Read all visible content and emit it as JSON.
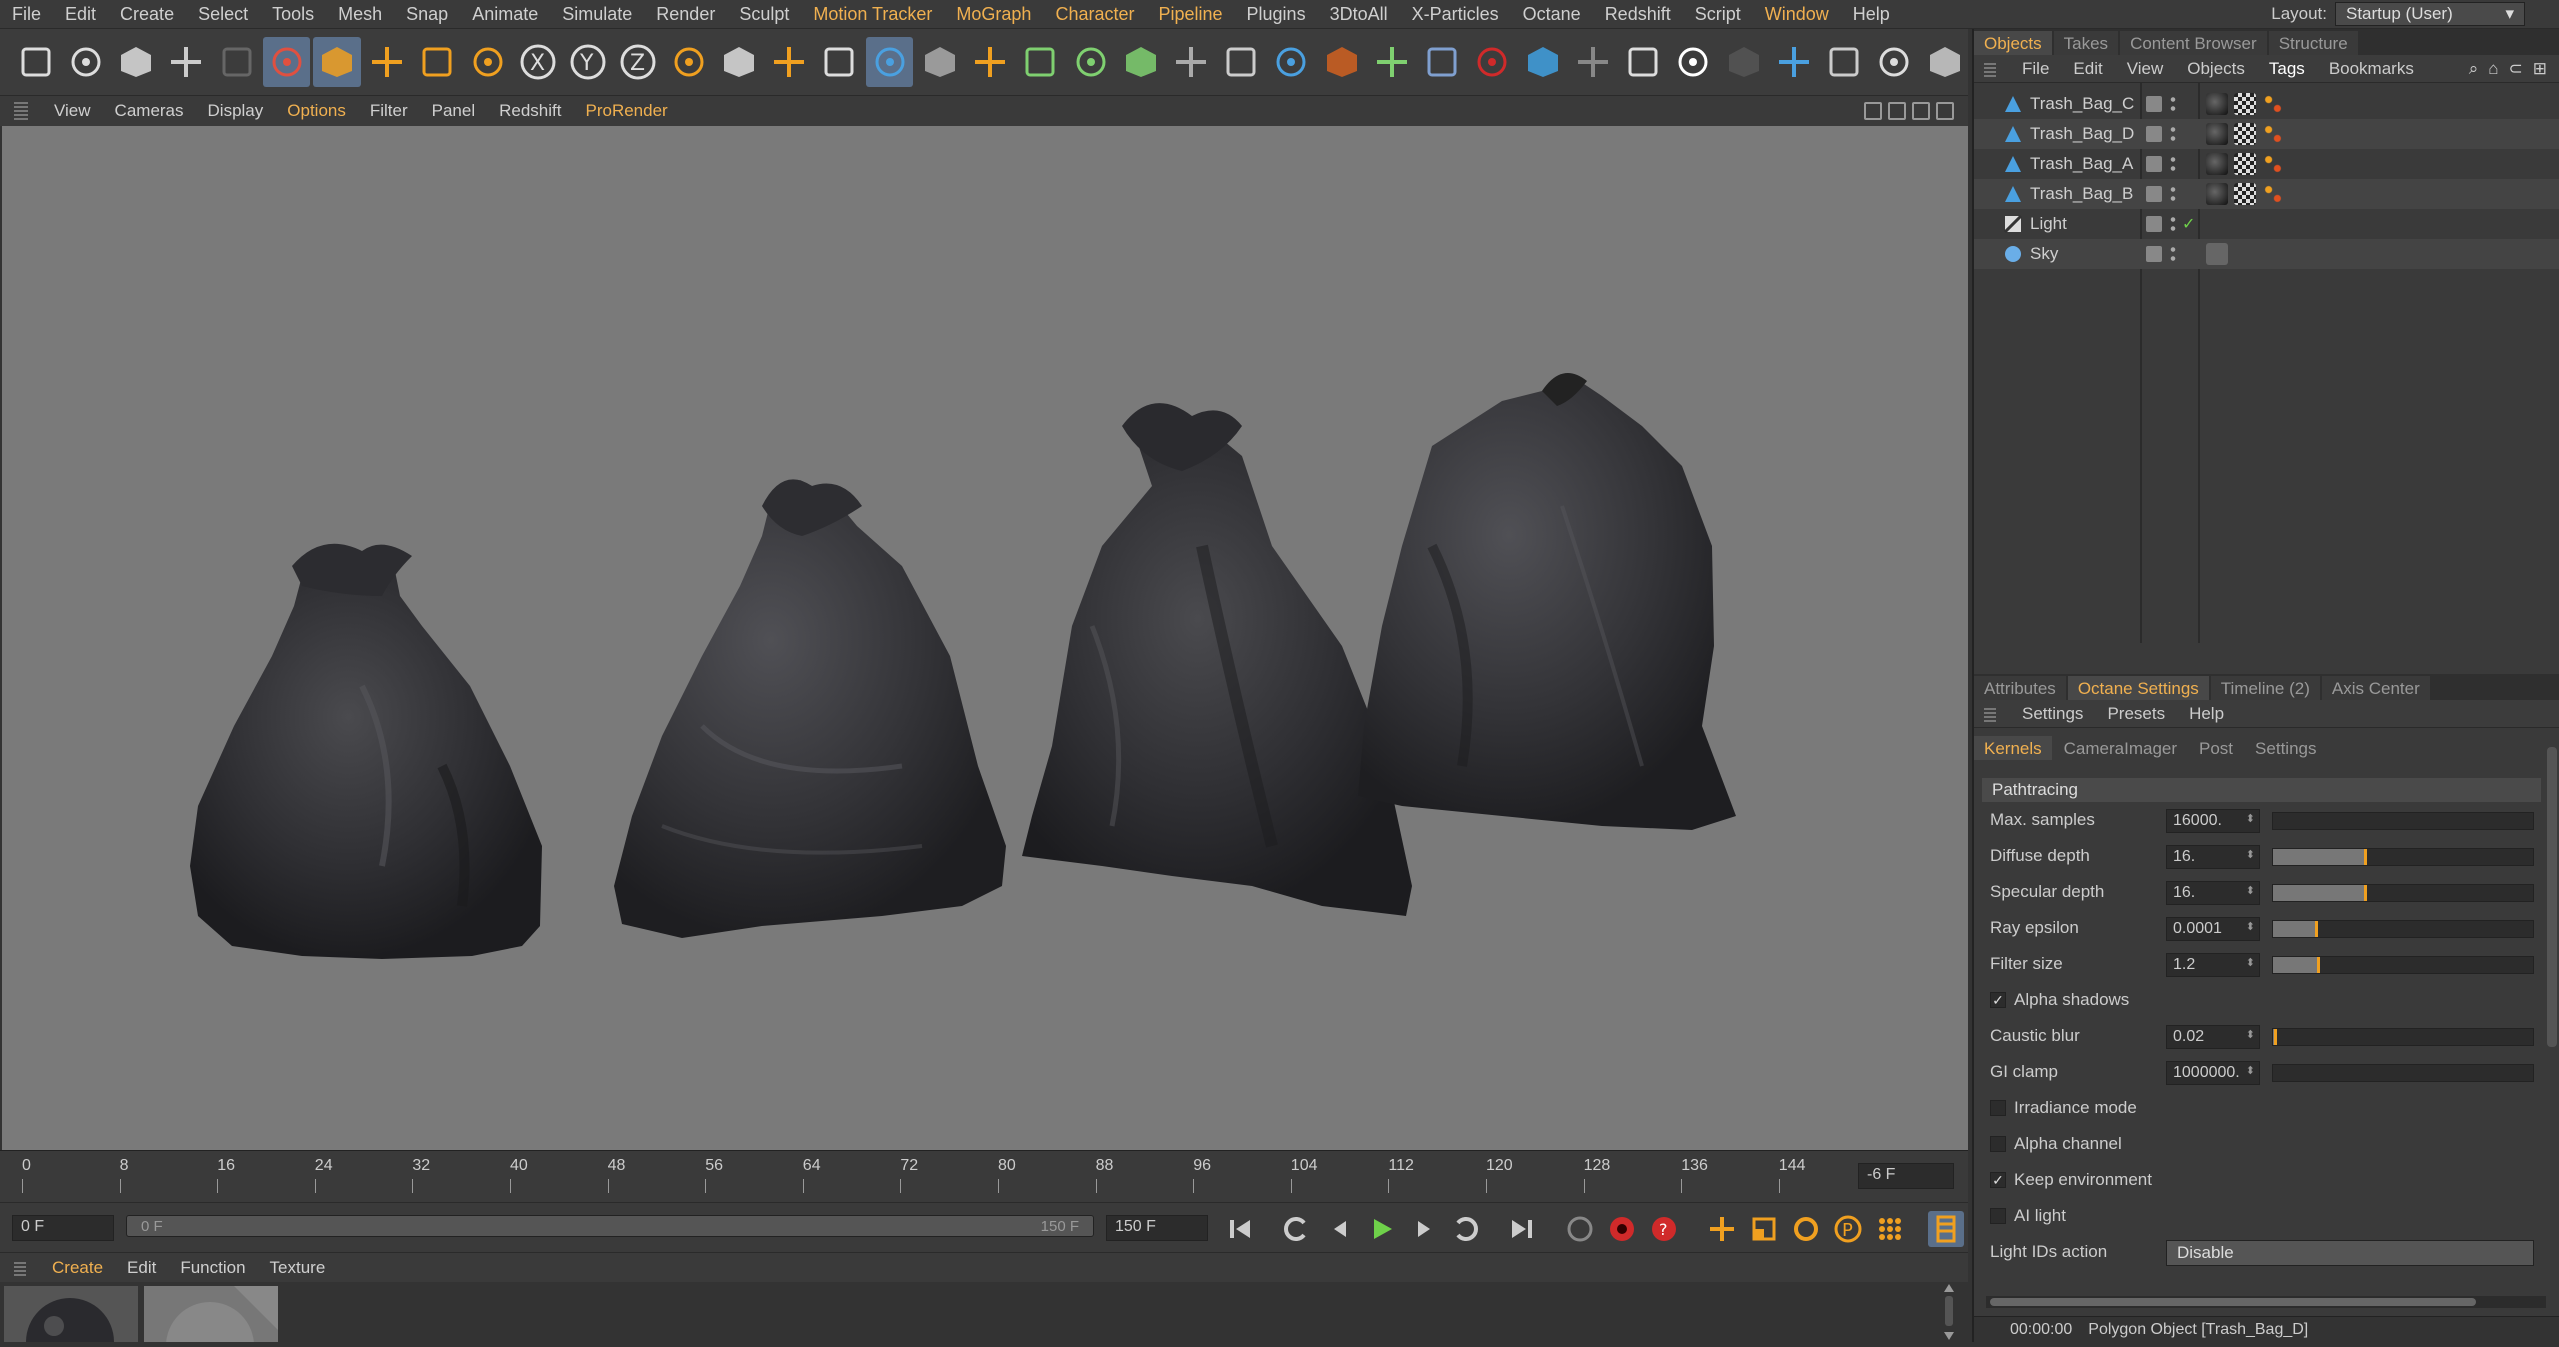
{
  "menu": [
    "File",
    "Edit",
    "Create",
    "Select",
    "Tools",
    "Mesh",
    "Snap",
    "Animate",
    "Simulate",
    "Render",
    "Sculpt",
    "Motion Tracker",
    "MoGraph",
    "Character",
    "Pipeline",
    "Plugins",
    "3DtoAll",
    "X-Particles",
    "Octane",
    "Redshift",
    "Script",
    "Window",
    "Help"
  ],
  "layout": {
    "label": "Layout:",
    "value": "Startup (User)"
  },
  "toolbar_icons": [
    "new-document-icon",
    "open-icon",
    "open-recent-icon",
    "undo-icon",
    "redo-icon",
    "live-selection-icon",
    "move-icon",
    "scale-icon",
    "rotate-icon",
    "recent-tool-icon",
    "x-axis-icon",
    "y-axis-icon",
    "z-axis-icon",
    "coordinate-system-icon",
    "render-view-icon",
    "render-picture-viewer-icon",
    "render-settings-icon",
    "cube-icon",
    "subdivision-icon",
    "spline-pen-icon",
    "polygon-pen-icon",
    "deformer-icon",
    "array-icon",
    "floor-icon",
    "light-icon",
    "camera-icon",
    "octane-live-viewer-icon",
    "octane-settings-icon",
    "octane-material-icon",
    "octane-object-icon",
    "octane-sky-icon",
    "octane-camera-icon",
    "octane-tag-icon",
    "octane-render-icon",
    "octane-contrast-icon",
    "octane-environment-icon",
    "octane-mix-icon",
    "octane-area-light-icon",
    "octane-output-icon"
  ],
  "viewport_menu": [
    "View",
    "Cameras",
    "Display",
    "Options",
    "Filter",
    "Panel",
    "Redshift",
    "ProRender"
  ],
  "timeline": {
    "ticks": [
      "0",
      "8",
      "16",
      "24",
      "32",
      "40",
      "48",
      "56",
      "64",
      "72",
      "80",
      "88",
      "96",
      "104",
      "112",
      "120",
      "128",
      "136",
      "144"
    ],
    "current_frame_display": "-6 F"
  },
  "transport": {
    "start_field": "0 F",
    "slider_left": "0 F",
    "slider_right": "150 F",
    "end_field": "150 F"
  },
  "material_menu": [
    "Create",
    "Edit",
    "Function",
    "Texture"
  ],
  "object_manager": {
    "tabs": [
      "Objects",
      "Takes",
      "Content Browser",
      "Structure"
    ],
    "menu": [
      "File",
      "Edit",
      "View",
      "Objects",
      "Tags",
      "Bookmarks"
    ],
    "objects": [
      {
        "name": "Trash_Bag_C",
        "type": "polygon"
      },
      {
        "name": "Trash_Bag_D",
        "type": "polygon"
      },
      {
        "name": "Trash_Bag_A",
        "type": "polygon"
      },
      {
        "name": "Trash_Bag_B",
        "type": "polygon"
      },
      {
        "name": "Light",
        "type": "light"
      },
      {
        "name": "Sky",
        "type": "sky"
      }
    ]
  },
  "attributes": {
    "tabs": [
      "Attributes",
      "Octane Settings",
      "Timeline (2)",
      "Axis Center"
    ],
    "menu": [
      "Settings",
      "Presets",
      "Help"
    ],
    "subtabs": [
      "Kernels",
      "CameraImager",
      "Post",
      "Settings"
    ],
    "section": "Pathtracing",
    "params": [
      {
        "label": "Max. samples",
        "value": "16000."
      },
      {
        "label": "Diffuse depth",
        "value": "16."
      },
      {
        "label": "Specular depth",
        "value": "16."
      },
      {
        "label": "Ray epsilon",
        "value": "0.0001"
      },
      {
        "label": "Filter size",
        "value": "1.2"
      }
    ],
    "alpha_shadows": "Alpha shadows",
    "params2": [
      {
        "label": "Caustic blur",
        "value": "0.02"
      },
      {
        "label": "GI clamp",
        "value": "1000000."
      }
    ],
    "checks": [
      {
        "label": "Irradiance mode",
        "checked": false
      },
      {
        "label": "Alpha channel",
        "checked": false
      },
      {
        "label": "Keep environment",
        "checked": true
      },
      {
        "label": "AI light",
        "checked": false
      }
    ],
    "light_ids": {
      "label": "Light IDs action",
      "value": "Disable"
    }
  },
  "status": {
    "time": "00:00:00",
    "message": "Polygon Object [Trash_Bag_D]"
  },
  "colors": {
    "accent": "#f0b050",
    "viewport_bg": "#7a7a7a",
    "panel_bg": "#3a3a3a"
  }
}
